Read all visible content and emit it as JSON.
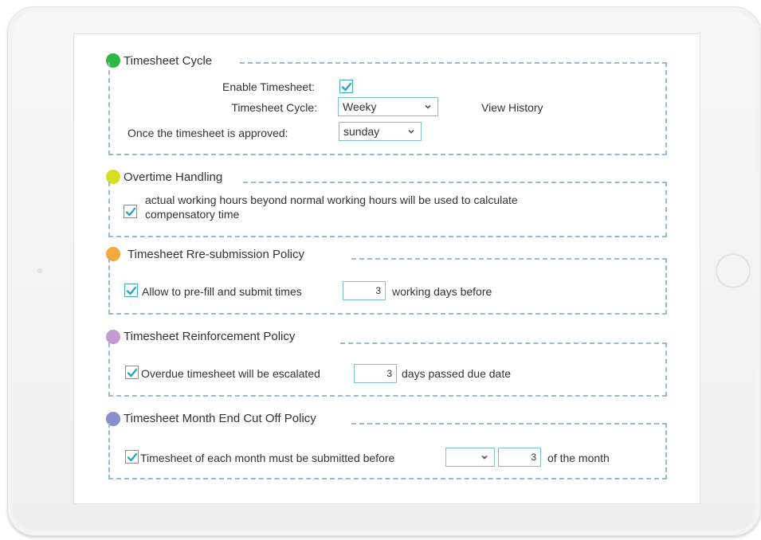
{
  "colors": {
    "dot_green": "#2db944",
    "dot_yellow": "#d7e01f",
    "dot_orange": "#f5a83b",
    "dot_purple": "#c49ad3",
    "dot_blue": "#8d8fcc",
    "border_dashed": "#9db9c9",
    "check_mark": "#2fa3c3"
  },
  "cycle": {
    "title": "Timesheet Cycle",
    "enable_label": "Enable Timesheet:",
    "enable_checked": true,
    "cycle_label": "Timesheet Cycle:",
    "cycle_value": "Weeky",
    "view_history": "View History",
    "approved_label": "Once the timesheet is approved:",
    "approved_value": "sunday"
  },
  "overtime": {
    "title": "Overtime Handling",
    "checked": true,
    "text_line1": "actual working hours beyond normal working hours will be used to calculate",
    "text_line2": "compensatory time"
  },
  "resubmission": {
    "title": "Timesheet Rre-submission Policy",
    "checked": true,
    "text_before": "Allow to pre-fill and submit times",
    "value": "3",
    "text_after": "working days before"
  },
  "reinforcement": {
    "title": "Timesheet Reinforcement Policy",
    "checked": true,
    "text_before": "Overdue timesheet will be escalated",
    "value": "3",
    "text_after": "days passed due date"
  },
  "monthend": {
    "title": "Timesheet Month End Cut Off Policy",
    "checked": true,
    "text_before": "Timesheet of each month must be submitted before",
    "select_value": "",
    "value": "3",
    "text_after": "of the month"
  }
}
